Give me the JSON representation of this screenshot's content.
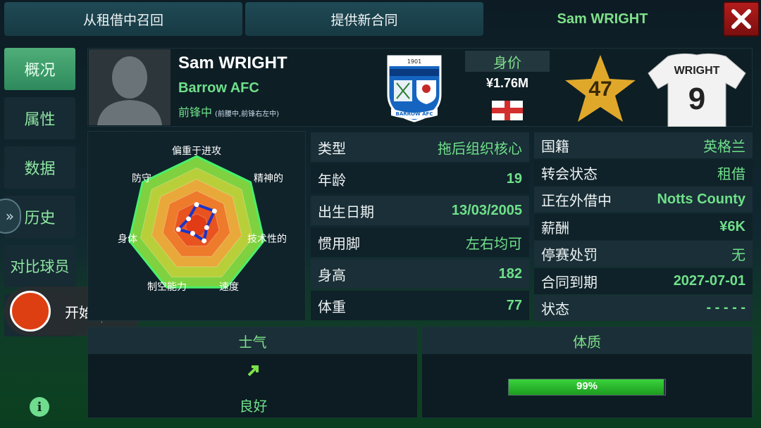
{
  "topbar": {
    "recall_loan_label": "从租借中召回",
    "offer_contract_label": "提供新合同",
    "title": "Sam WRIGHT"
  },
  "sidebar": {
    "items": [
      {
        "label": "概况",
        "active": true
      },
      {
        "label": "属性",
        "active": false
      },
      {
        "label": "数据",
        "active": false
      },
      {
        "label": "历史",
        "active": false
      },
      {
        "label": "对比球员",
        "active": false
      }
    ]
  },
  "recorder": {
    "label": "开始",
    "close": "×"
  },
  "player": {
    "name": "Sam WRIGHT",
    "club": "Barrow AFC",
    "position": "前锋中",
    "position_detail": "(前腰中,前锋右左中)",
    "value_label": "身价",
    "value": "¥1.76M",
    "rating": "47",
    "shirt_name": "WRIGHT",
    "shirt_number": "9",
    "crest": {
      "year": "1901",
      "banner": "BARROW AFC"
    }
  },
  "radar": {
    "labels": [
      "偏重于进攻",
      "精神的",
      "技术性的",
      "速度",
      "制空能力",
      "身体",
      "防守"
    ],
    "values": [
      0.3,
      0.33,
      0.15,
      0.25,
      0.13,
      0.27,
      0.15
    ]
  },
  "bio": [
    {
      "key": "类型",
      "value": "拖后组织核心"
    },
    {
      "key": "年龄",
      "value": "19"
    },
    {
      "key": "出生日期",
      "value": "13/03/2005"
    },
    {
      "key": "惯用脚",
      "value": "左右均可"
    },
    {
      "key": "身高",
      "value": "182"
    },
    {
      "key": "体重",
      "value": "77"
    }
  ],
  "contract": [
    {
      "key": "国籍",
      "value": "英格兰"
    },
    {
      "key": "转会状态",
      "value": "租借"
    },
    {
      "key": "正在外借中",
      "value": "Notts County"
    },
    {
      "key": "薪酬",
      "value": "¥6K"
    },
    {
      "key": "停赛处罚",
      "value": "无"
    },
    {
      "key": "合同到期",
      "value": "2027-07-01"
    },
    {
      "key": "状态",
      "value": "- - - - -"
    }
  ],
  "morale": {
    "title": "士气",
    "value": "良好"
  },
  "fitness": {
    "title": "体质",
    "percent": 99,
    "label": "99%"
  },
  "colors": {
    "accent": "#6fe08a",
    "star": "#e0a82a",
    "close": "#b51c1c"
  }
}
